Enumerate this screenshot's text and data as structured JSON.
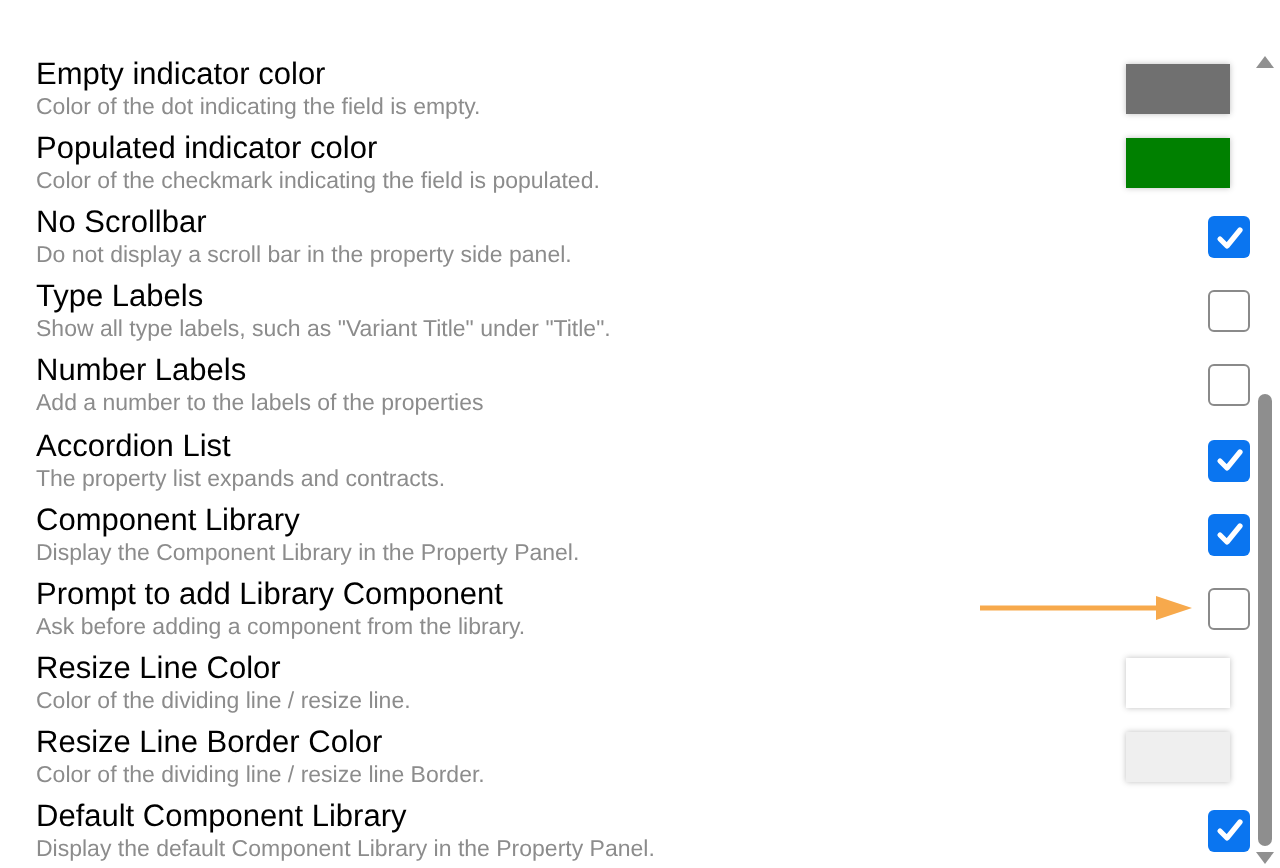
{
  "settings": [
    {
      "kind": "color",
      "title": "Empty indicator color",
      "description": "Color of the dot indicating the field is empty.",
      "color": "#707070"
    },
    {
      "kind": "color",
      "title": "Populated indicator color",
      "description": "Color of the checkmark indicating the field is populated.",
      "color": "#008000"
    },
    {
      "kind": "checkbox",
      "title": "No Scrollbar",
      "description": "Do not display a scroll bar in the property side panel.",
      "checked": true
    },
    {
      "kind": "checkbox",
      "title": "Type Labels",
      "description": "Show all type labels, such as \"Variant Title\" under \"Title\".",
      "checked": false
    },
    {
      "kind": "checkbox",
      "title": "Number Labels",
      "description": "Add a number to the labels of the properties",
      "checked": false
    },
    {
      "kind": "checkbox",
      "title": "Accordion List",
      "description": "The property list expands and contracts.",
      "checked": true
    },
    {
      "kind": "checkbox",
      "title": "Component Library",
      "description": "Display the Component Library in the Property Panel.",
      "checked": true
    },
    {
      "kind": "checkbox",
      "title": "Prompt to add Library Component",
      "description": "Ask before adding a component from the library.",
      "checked": false,
      "pointed": true
    },
    {
      "kind": "color",
      "title": "Resize Line Color",
      "description": "Color of the dividing line / resize line.",
      "color": "#ffffff"
    },
    {
      "kind": "color",
      "title": "Resize Line Border Color",
      "description": "Color of the dividing line / resize line Border.",
      "color": "#efefef"
    },
    {
      "kind": "checkbox",
      "title": "Default Component Library",
      "description": "Display the default Component Library in the Property Panel.",
      "checked": true
    }
  ]
}
